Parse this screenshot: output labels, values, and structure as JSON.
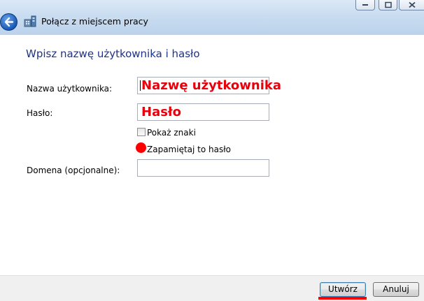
{
  "window": {
    "title": "Połącz z miejscem pracy"
  },
  "page": {
    "heading": "Wpisz nazwę użytkownika i hasło"
  },
  "form": {
    "username_label": "Nazwa użytkownika:",
    "username_value": "Nazwę użytkownika",
    "password_label": "Hasło:",
    "password_value": "Hasło",
    "show_chars_label": "Pokaż znaki",
    "show_chars_checked": false,
    "remember_label": "Zapamiętaj to hasło",
    "domain_label": "Domena (opcjonalne):",
    "domain_value": ""
  },
  "footer": {
    "create_label": "Utwórz",
    "cancel_label": "Anuluj"
  },
  "colors": {
    "heading": "#1e3287",
    "annotation_red": "#e8000b"
  }
}
